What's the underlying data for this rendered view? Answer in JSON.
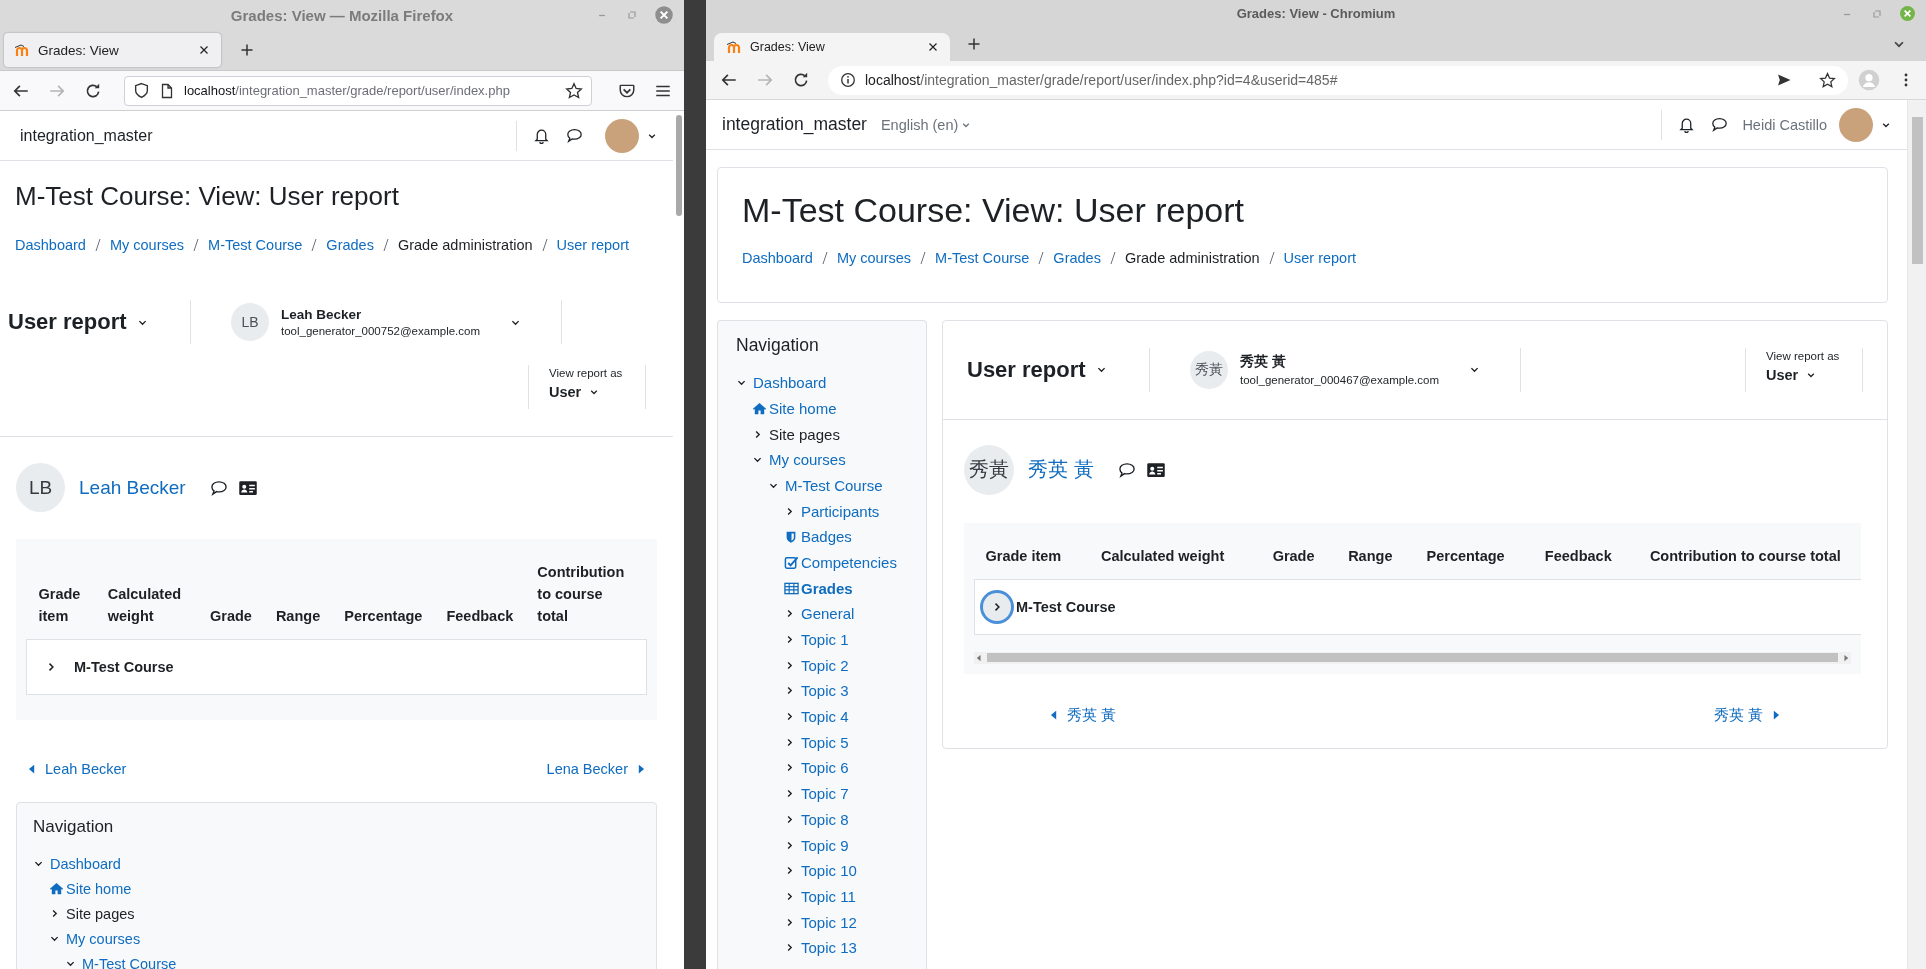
{
  "windows": [
    {
      "kind": "firefox",
      "title": "Grades: View — Mozilla Firefox",
      "tab": "Grades: View",
      "can_go_forward": false,
      "url_host": "localhost",
      "url_path": "/integration_master/grade/report/user/index.php",
      "site_name": "integration_master",
      "page_title": "M-Test Course: View: User report",
      "breadcrumb": [
        {
          "label": "Dashboard",
          "link": true
        },
        {
          "label": "My courses",
          "link": true
        },
        {
          "label": "M-Test Course",
          "link": true
        },
        {
          "label": "Grades",
          "link": true
        },
        {
          "label": "Grade administration",
          "link": false
        },
        {
          "label": "User report",
          "link": true
        }
      ],
      "report_menu": "User report",
      "user_menu": {
        "initials": "LB",
        "name": "Leah Becker",
        "email": "tool_generator_000752@example.com"
      },
      "view_as": {
        "label": "View report as",
        "value": "User"
      },
      "user": {
        "initials": "LB",
        "name": "Leah Becker"
      },
      "table": {
        "columns": [
          "Grade item",
          "Calculated weight",
          "Grade",
          "Range",
          "Percentage",
          "Feedback",
          "Contribution to course total"
        ],
        "rows": [
          {
            "item": "M-Test Course",
            "focused": false
          }
        ],
        "horizontal_scrollbar": false
      },
      "previous_user": "Leah Becker",
      "next_user": "Lena Becker",
      "navigation": {
        "title": "Navigation",
        "items": [
          {
            "label": "Dashboard",
            "kind": "expanded",
            "link": true,
            "selected": false,
            "children": [
              {
                "label": "Site home",
                "kind": "home",
                "link": true,
                "selected": false
              },
              {
                "label": "Site pages",
                "kind": "collapsed",
                "link": false,
                "selected": false
              },
              {
                "label": "My courses",
                "kind": "expanded",
                "link": true,
                "selected": false,
                "children": [
                  {
                    "label": "M-Test Course",
                    "kind": "expanded",
                    "link": true,
                    "selected": false
                  }
                ]
              }
            ]
          }
        ]
      }
    },
    {
      "kind": "chromium",
      "title": "Grades: View - Chromium",
      "tab": "Grades: View",
      "can_go_forward": false,
      "url_host": "localhost",
      "url_path": "/integration_master/grade/report/user/index.php?id=4&userid=485#",
      "site_name": "integration_master",
      "language": "English (en)",
      "account_name": "Heidi Castillo",
      "page_title": "M-Test Course: View: User report",
      "breadcrumb": [
        {
          "label": "Dashboard",
          "link": true
        },
        {
          "label": "My courses",
          "link": true
        },
        {
          "label": "M-Test Course",
          "link": true
        },
        {
          "label": "Grades",
          "link": true
        },
        {
          "label": "Grade administration",
          "link": false
        },
        {
          "label": "User report",
          "link": true
        }
      ],
      "report_menu": "User report",
      "user_menu": {
        "initials": "秀黃",
        "name": "秀英 黃",
        "email": "tool_generator_000467@example.com"
      },
      "view_as": {
        "label": "View report as",
        "value": "User"
      },
      "user": {
        "initials": "秀黃",
        "name": "秀英 黃"
      },
      "table": {
        "columns": [
          "Grade item",
          "Calculated weight",
          "Grade",
          "Range",
          "Percentage",
          "Feedback",
          "Contribution to course total"
        ],
        "rows": [
          {
            "item": "M-Test Course",
            "focused": true
          }
        ],
        "horizontal_scrollbar": true
      },
      "previous_user": "秀英 黃",
      "next_user": "秀英 黃",
      "navigation": {
        "title": "Navigation",
        "items": [
          {
            "label": "Dashboard",
            "kind": "expanded",
            "link": true,
            "selected": false,
            "children": [
              {
                "label": "Site home",
                "kind": "home",
                "link": true,
                "selected": false
              },
              {
                "label": "Site pages",
                "kind": "collapsed",
                "link": false,
                "selected": false
              },
              {
                "label": "My courses",
                "kind": "expanded",
                "link": true,
                "selected": false,
                "children": [
                  {
                    "label": "M-Test Course",
                    "kind": "expanded",
                    "link": true,
                    "selected": false,
                    "children": [
                      {
                        "label": "Participants",
                        "kind": "collapsed",
                        "link": true,
                        "selected": false
                      },
                      {
                        "label": "Badges",
                        "kind": "badge",
                        "link": true,
                        "selected": false
                      },
                      {
                        "label": "Competencies",
                        "kind": "checkbox",
                        "link": true,
                        "selected": false
                      },
                      {
                        "label": "Grades",
                        "kind": "table",
                        "link": true,
                        "selected": true
                      },
                      {
                        "label": "General",
                        "kind": "collapsed",
                        "link": true,
                        "selected": false
                      },
                      {
                        "label": "Topic 1",
                        "kind": "collapsed",
                        "link": true,
                        "selected": false
                      },
                      {
                        "label": "Topic 2",
                        "kind": "collapsed",
                        "link": true,
                        "selected": false
                      },
                      {
                        "label": "Topic 3",
                        "kind": "collapsed",
                        "link": true,
                        "selected": false
                      },
                      {
                        "label": "Topic 4",
                        "kind": "collapsed",
                        "link": true,
                        "selected": false
                      },
                      {
                        "label": "Topic 5",
                        "kind": "collapsed",
                        "link": true,
                        "selected": false
                      },
                      {
                        "label": "Topic 6",
                        "kind": "collapsed",
                        "link": true,
                        "selected": false
                      },
                      {
                        "label": "Topic 7",
                        "kind": "collapsed",
                        "link": true,
                        "selected": false
                      },
                      {
                        "label": "Topic 8",
                        "kind": "collapsed",
                        "link": true,
                        "selected": false
                      },
                      {
                        "label": "Topic 9",
                        "kind": "collapsed",
                        "link": true,
                        "selected": false
                      },
                      {
                        "label": "Topic 10",
                        "kind": "collapsed",
                        "link": true,
                        "selected": false
                      },
                      {
                        "label": "Topic 11",
                        "kind": "collapsed",
                        "link": true,
                        "selected": false
                      },
                      {
                        "label": "Topic 12",
                        "kind": "collapsed",
                        "link": true,
                        "selected": false
                      },
                      {
                        "label": "Topic 13",
                        "kind": "collapsed",
                        "link": true,
                        "selected": false
                      }
                    ]
                  }
                ]
              }
            ]
          }
        ]
      }
    }
  ]
}
